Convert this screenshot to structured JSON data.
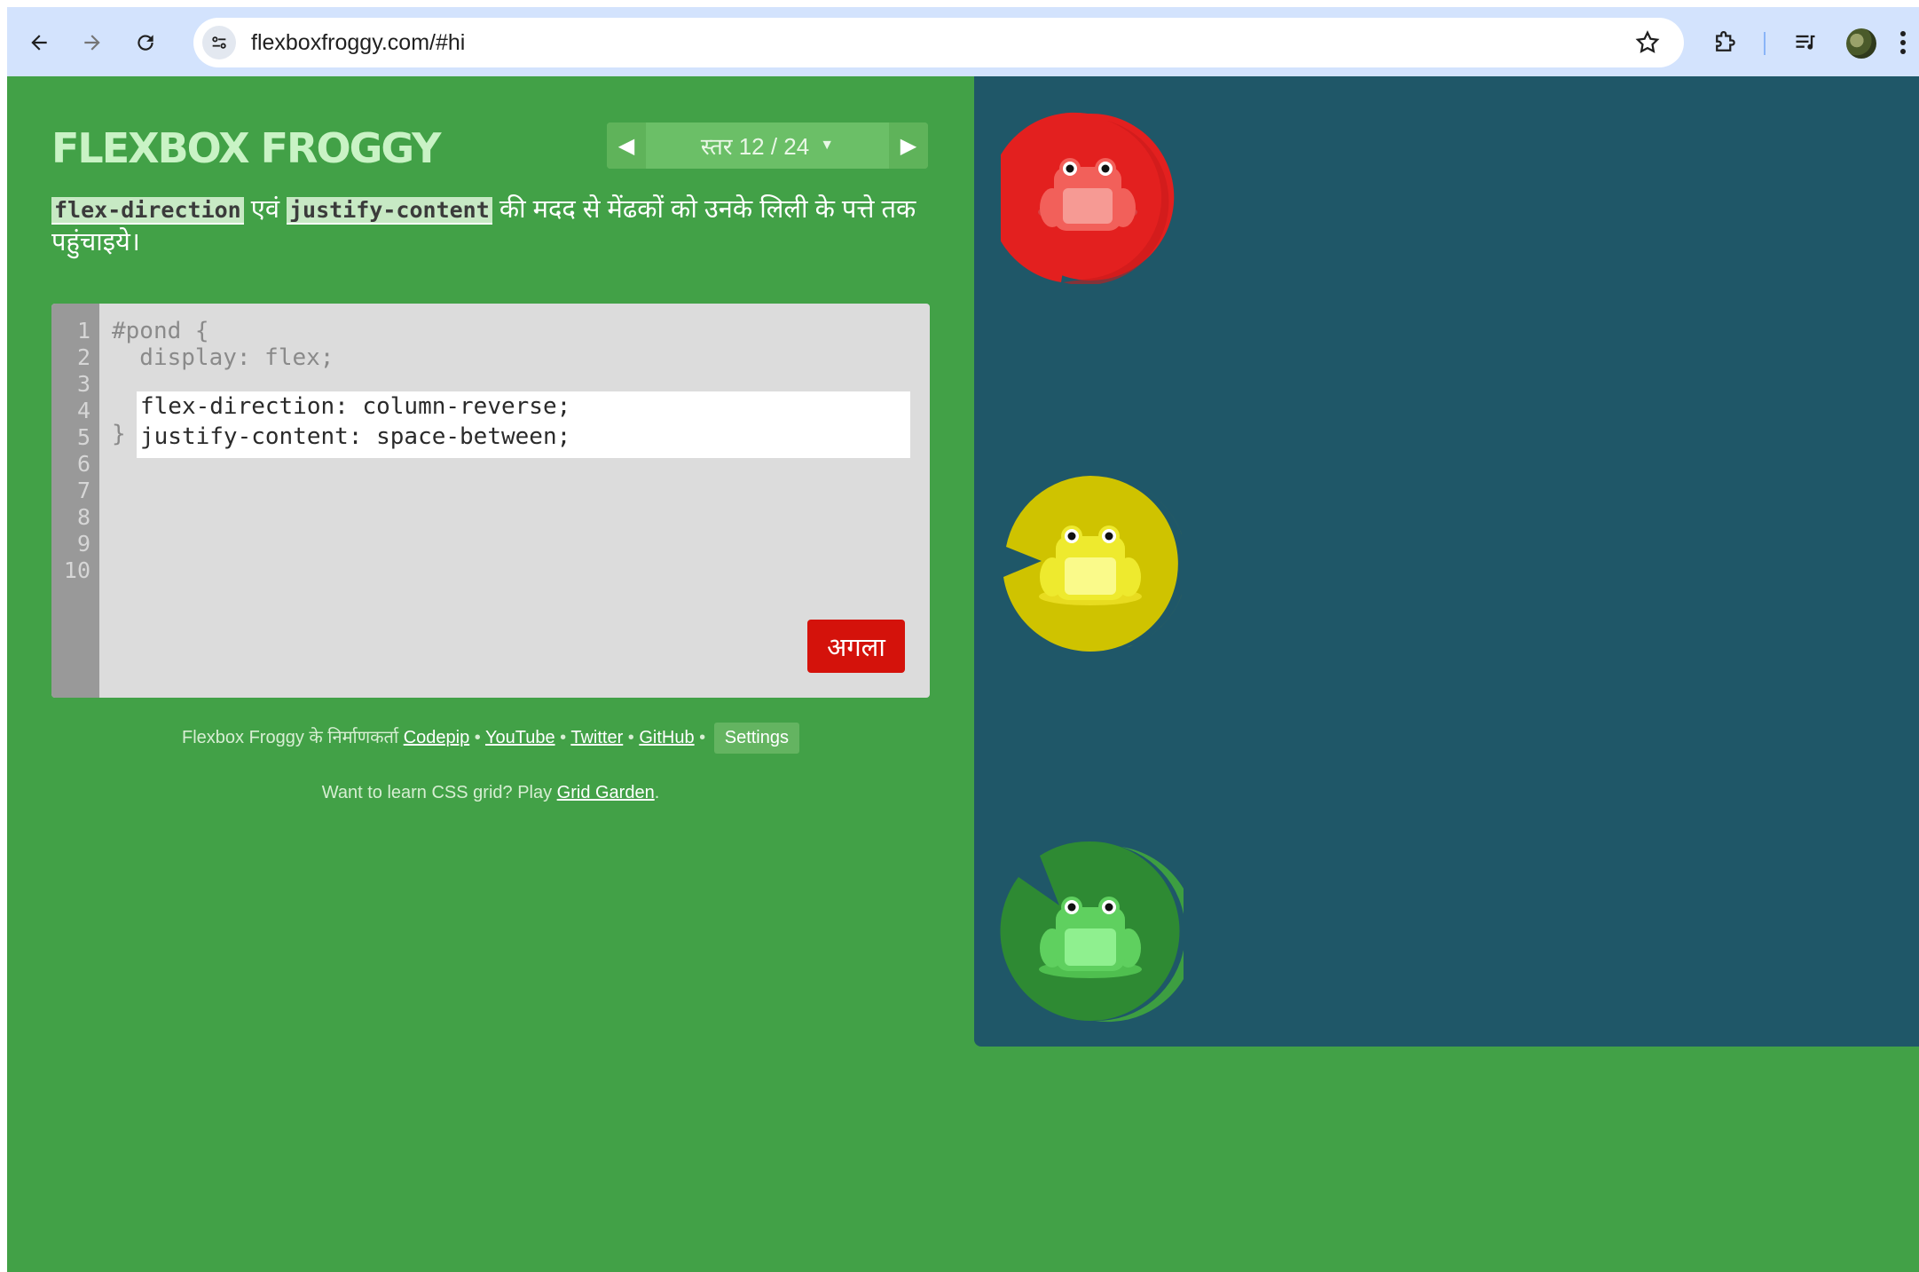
{
  "browser": {
    "url": "flexboxfroggy.com/#hi",
    "icons": [
      "back-arrow-icon",
      "forward-arrow-icon",
      "reload-icon",
      "site-info-icon",
      "bookmark-star-icon",
      "extensions-icon",
      "reading-list-icon",
      "profile-avatar",
      "more-menu-icon"
    ]
  },
  "game": {
    "logo": "FLEXBOX FROGGY",
    "level": "स्तर 12 / 24",
    "instructions": {
      "prop1": "flex-direction",
      "joiner": " एवं ",
      "prop2": "justify-content",
      "rest": " की मदद से मेंढकों को उनके लिली के पत्ते तक पहुंचाइये।"
    },
    "editor": {
      "line_numbers": [
        "1",
        "2",
        "3",
        "4",
        "5",
        "6",
        "7",
        "8",
        "9",
        "10"
      ],
      "line1": "#pond {",
      "line2": "  display: flex;",
      "input_line1": "flex-direction: column-reverse;",
      "input_line2": "justify-content: space-between;",
      "line5": "}",
      "next_label": "अगला"
    },
    "credits": {
      "prefix": "Flexbox Froggy के निर्माणकर्ता ",
      "codepip": "Codepip",
      "youtube": "YouTube",
      "twitter": "Twitter",
      "github": "GitHub",
      "sep": " • ",
      "settings": "Settings"
    },
    "grid_note": {
      "text": "Want to learn CSS grid? Play ",
      "link": "Grid Garden",
      "end": "."
    },
    "pond": {
      "lilypads": [
        {
          "color": "#e3201f",
          "frog_color": "#f2605a"
        },
        {
          "color": "#cfc300",
          "frog_color": "#eeea2e"
        },
        {
          "color": "#2e8a33",
          "frog_color": "#5fd05f"
        }
      ]
    }
  }
}
